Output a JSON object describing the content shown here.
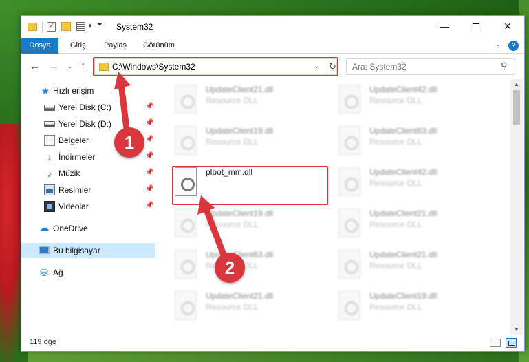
{
  "window": {
    "title": "System32",
    "minimize_icon": "minimize-icon",
    "maximize_icon": "maximize-icon",
    "close_icon": "close-icon"
  },
  "ribbon": {
    "tabs": [
      {
        "label": "Dosya",
        "active": true
      },
      {
        "label": "Giriş"
      },
      {
        "label": "Paylaş"
      },
      {
        "label": "Görünüm"
      }
    ]
  },
  "nav": {
    "address": "C:\\Windows\\System32",
    "search_placeholder": "Ara: System32"
  },
  "sidebar": {
    "items": [
      {
        "label": "Hızlı erişim",
        "icon": "star-icon"
      },
      {
        "label": "Yerel Disk (C:)",
        "icon": "drive-icon",
        "pinned": true
      },
      {
        "label": "Yerel Disk (D:)",
        "icon": "drive-icon",
        "pinned": true
      },
      {
        "label": "Belgeler",
        "icon": "documents-icon",
        "pinned": true
      },
      {
        "label": "İndirmeler",
        "icon": "download-icon",
        "pinned": true
      },
      {
        "label": "Müzik",
        "icon": "music-icon",
        "pinned": true
      },
      {
        "label": "Resimler",
        "icon": "pictures-icon",
        "pinned": true
      },
      {
        "label": "Videolar",
        "icon": "videos-icon",
        "pinned": true
      },
      {
        "label": "OneDrive",
        "icon": "cloud-icon"
      },
      {
        "label": "Bu bilgisayar",
        "icon": "computer-icon",
        "selected": true
      },
      {
        "label": "Ağ",
        "icon": "network-icon"
      }
    ]
  },
  "files": {
    "left": [
      {
        "name": "UpdateClient21.dll",
        "type": "Resource DLL"
      },
      {
        "name": "UpdateClient19.dll",
        "type": "Resource DLL"
      },
      {
        "name": "plbot_mm.dll",
        "type": ""
      },
      {
        "name": "UpdateClient19.dll",
        "type": "Resource DLL"
      },
      {
        "name": "UpdateClient63.dll",
        "type": "Resource DLL"
      },
      {
        "name": "UpdateClient21.dll",
        "type": "Resource DLL"
      }
    ],
    "right": [
      {
        "name": "UpdateClient42.dll",
        "type": "Resource DLL"
      },
      {
        "name": "UpdateClient63.dll",
        "type": "Resource DLL"
      },
      {
        "name": "UpdateClient42.dll",
        "type": "Resource DLL"
      },
      {
        "name": "UpdateClient21.dll",
        "type": "Resource DLL"
      },
      {
        "name": "UpdateClient21.dll",
        "type": "Resource DLL"
      },
      {
        "name": "UpdateClient19.dll",
        "type": "Resource DLL"
      }
    ]
  },
  "status": {
    "count": "119 öğe"
  },
  "annotations": {
    "step1": "1",
    "step2": "2",
    "highlight_color": "#d9363e"
  }
}
